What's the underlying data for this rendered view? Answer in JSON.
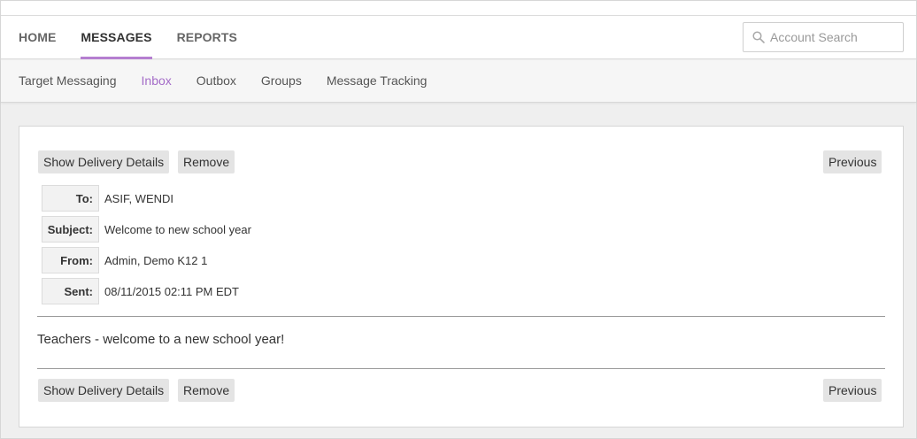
{
  "header": {
    "nav": [
      {
        "label": "HOME",
        "active": false
      },
      {
        "label": "MESSAGES",
        "active": true
      },
      {
        "label": "REPORTS",
        "active": false
      }
    ],
    "search": {
      "placeholder": "Account Search",
      "value": ""
    }
  },
  "subnav": [
    {
      "label": "Target Messaging",
      "active": false
    },
    {
      "label": "Inbox",
      "active": true
    },
    {
      "label": "Outbox",
      "active": false
    },
    {
      "label": "Groups",
      "active": false
    },
    {
      "label": "Message Tracking",
      "active": false
    }
  ],
  "actions": {
    "show_delivery_details": "Show Delivery Details",
    "remove": "Remove",
    "previous": "Previous"
  },
  "message": {
    "fields": [
      {
        "label": "To:",
        "value": "ASIF, WENDI"
      },
      {
        "label": "Subject:",
        "value": "Welcome to new school year"
      },
      {
        "label": "From:",
        "value": "Admin, Demo K12 1"
      },
      {
        "label": "Sent:",
        "value": "08/11/2015 02:11 PM EDT"
      }
    ],
    "body": "Teachers - welcome to a new school year!"
  },
  "colors": {
    "accent": "#b57fd0",
    "subnav_active": "#a46cc8"
  },
  "icons": {
    "search": "search-icon"
  }
}
